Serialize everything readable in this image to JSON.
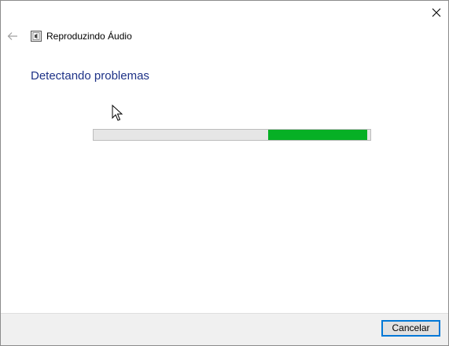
{
  "window": {
    "title": "Reproduzindo Áudio",
    "app_icon": "audio-troubleshooter-icon",
    "close_icon": "close-icon",
    "back_icon": "back-arrow-icon"
  },
  "main": {
    "heading": "Detectando problemas",
    "progress": {
      "indeterminate_segment_start": 0.63,
      "indeterminate_segment_end": 0.99,
      "fill_color": "#06b025",
      "track_color": "#e6e6e6"
    }
  },
  "footer": {
    "cancel_label": "Cancelar"
  },
  "colors": {
    "heading": "#1e3287",
    "focus_border": "#0078d7"
  }
}
